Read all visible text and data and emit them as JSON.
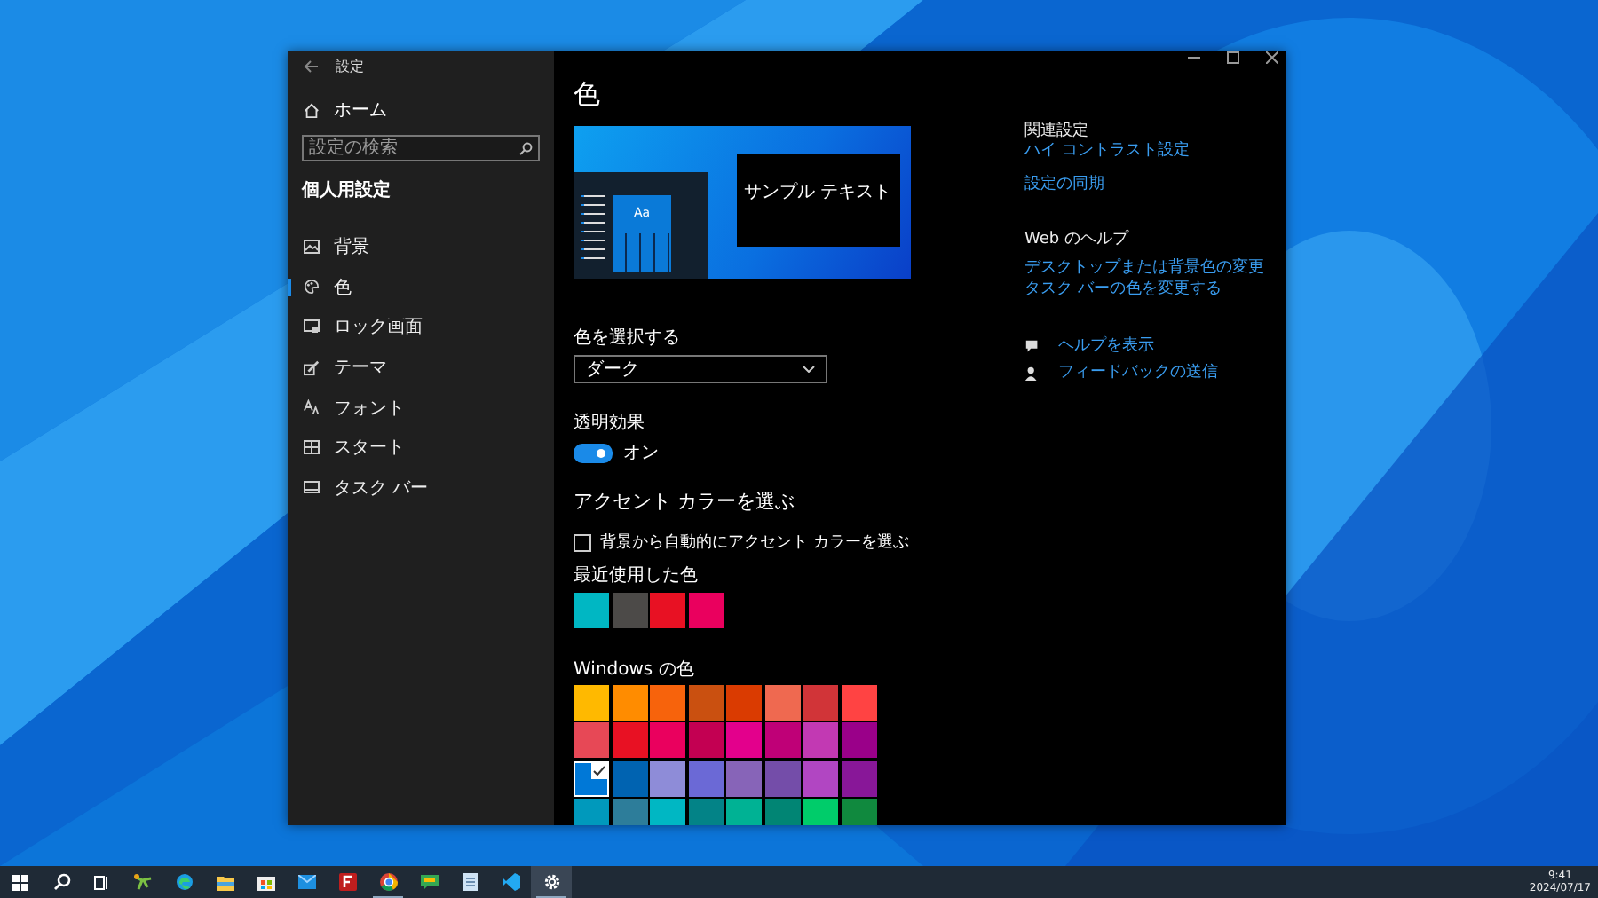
{
  "window": {
    "title": "設定"
  },
  "sidebar": {
    "home": "ホーム",
    "search": {
      "placeholder": "設定の検索"
    },
    "section": "個人用設定",
    "items": [
      {
        "label": "背景",
        "kind": "background",
        "selected": false
      },
      {
        "label": "色",
        "kind": "colors",
        "selected": true
      },
      {
        "label": "ロック画面",
        "kind": "lock",
        "selected": false
      },
      {
        "label": "テーマ",
        "kind": "theme",
        "selected": false
      },
      {
        "label": "フォント",
        "kind": "font",
        "selected": false
      },
      {
        "label": "スタート",
        "kind": "start",
        "selected": false
      },
      {
        "label": "タスク バー",
        "kind": "taskbar",
        "selected": false
      }
    ]
  },
  "main": {
    "heading": "色",
    "preview": {
      "sample_text": "サンプル テキスト",
      "tile_text": "Aa"
    },
    "mode": {
      "label": "色を選択する",
      "value": "ダーク"
    },
    "transparency": {
      "label": "透明効果",
      "on": true,
      "state_text": "オン"
    },
    "accent_heading": "アクセント カラーを選ぶ",
    "auto_accent": {
      "label": "背景から自動的にアクセント カラーを選ぶ",
      "checked": false
    },
    "recent": {
      "label": "最近使用した色",
      "colors": [
        {
          "color": "#00b7c3"
        },
        {
          "color": "#4c4a48"
        },
        {
          "color": "#e81123"
        },
        {
          "color": "#ea005e"
        }
      ]
    },
    "windows_colors": {
      "label": "Windows の色",
      "colors": [
        {
          "color": "#ffb900",
          "selected": false
        },
        {
          "color": "#ff8c00",
          "selected": false
        },
        {
          "color": "#f7630c",
          "selected": false
        },
        {
          "color": "#ca5010",
          "selected": false
        },
        {
          "color": "#da3b01",
          "selected": false
        },
        {
          "color": "#ef6950",
          "selected": false
        },
        {
          "color": "#d13438",
          "selected": false
        },
        {
          "color": "#ff4343",
          "selected": false
        },
        {
          "color": "#e74856",
          "selected": false
        },
        {
          "color": "#e81123",
          "selected": false
        },
        {
          "color": "#ea005e",
          "selected": false
        },
        {
          "color": "#c30052",
          "selected": false
        },
        {
          "color": "#e3008c",
          "selected": false
        },
        {
          "color": "#bf0077",
          "selected": false
        },
        {
          "color": "#c239b3",
          "selected": false
        },
        {
          "color": "#9a0089",
          "selected": false
        },
        {
          "color": "#0078d7",
          "selected": true
        },
        {
          "color": "#0063b1",
          "selected": false
        },
        {
          "color": "#8e8cd8",
          "selected": false
        },
        {
          "color": "#6b69d6",
          "selected": false
        },
        {
          "color": "#8764b8",
          "selected": false
        },
        {
          "color": "#744da9",
          "selected": false
        },
        {
          "color": "#b146c2",
          "selected": false
        },
        {
          "color": "#881798",
          "selected": false
        },
        {
          "color": "#0099bc",
          "selected": false
        },
        {
          "color": "#2d7d9a",
          "selected": false
        },
        {
          "color": "#00b7c3",
          "selected": false
        },
        {
          "color": "#038387",
          "selected": false
        },
        {
          "color": "#00b294",
          "selected": false
        },
        {
          "color": "#018574",
          "selected": false
        },
        {
          "color": "#00cc6a",
          "selected": false
        },
        {
          "color": "#10893e",
          "selected": false
        }
      ]
    }
  },
  "related": {
    "heading": "関連設定",
    "links": [
      "ハイ コントラスト設定",
      "設定の同期"
    ]
  },
  "web_help": {
    "heading": "Web のヘルプ",
    "links": [
      "デスクトップまたは背景色の変更",
      "タスク バーの色を変更する"
    ]
  },
  "help_links": [
    {
      "label": "ヘルプを表示",
      "kind": "help"
    },
    {
      "label": "フィードバックの送信",
      "kind": "feedback"
    }
  ],
  "taskbar": {
    "icons": [
      {
        "kind": "start",
        "running": false,
        "selected": false
      },
      {
        "kind": "search",
        "running": false,
        "selected": false
      },
      {
        "kind": "taskview",
        "running": false,
        "selected": false
      },
      {
        "kind": "tool",
        "running": false,
        "selected": false
      },
      {
        "kind": "edge",
        "running": false,
        "selected": false
      },
      {
        "kind": "folder",
        "running": false,
        "selected": false
      },
      {
        "kind": "store",
        "running": false,
        "selected": false
      },
      {
        "kind": "mail",
        "running": false,
        "selected": false
      },
      {
        "kind": "ftp",
        "running": false,
        "selected": false
      },
      {
        "kind": "chrome",
        "running": true,
        "selected": false
      },
      {
        "kind": "chat",
        "running": false,
        "selected": false
      },
      {
        "kind": "notepad",
        "running": false,
        "selected": false
      },
      {
        "kind": "code",
        "running": false,
        "selected": false
      },
      {
        "kind": "settings",
        "running": true,
        "selected": true
      }
    ],
    "time": "9:41",
    "date": "2024/07/17"
  }
}
